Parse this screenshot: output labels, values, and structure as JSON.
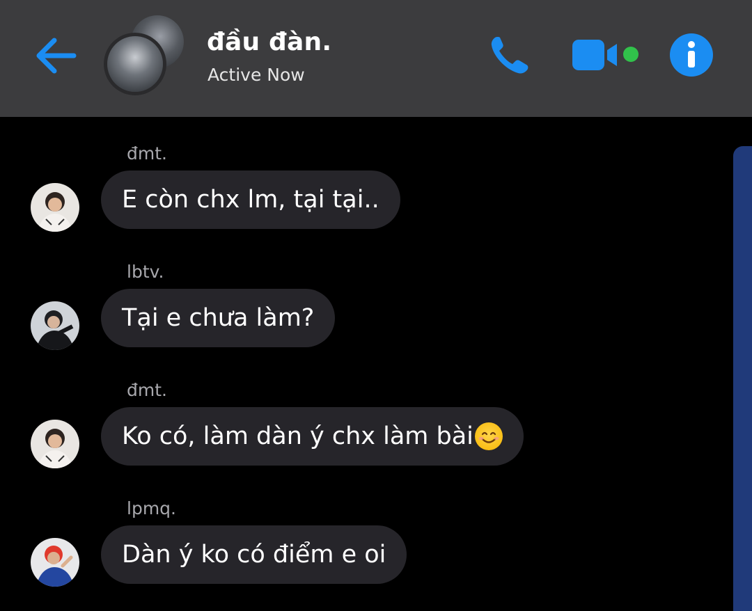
{
  "header": {
    "contact_name": "đầu đàn.",
    "status": "Active Now",
    "accent_color": "#1b8df2",
    "active_color": "#31c24b",
    "icons": [
      "back-arrow-icon",
      "phone-icon",
      "video-camera-icon",
      "info-icon"
    ]
  },
  "messages": [
    {
      "sender": "đmt.",
      "text": "E còn chx lm, tại tại..",
      "avatar": "avatar-dmt"
    },
    {
      "sender": "lbtv.",
      "text": "Tại e chưa làm?",
      "avatar": "avatar-lbtv"
    },
    {
      "sender": "đmt.",
      "text": "Ko có, làm dàn ý chx làm bài",
      "emoji": "smiling-face-emoji",
      "avatar": "avatar-dmt"
    },
    {
      "sender": "lpmq.",
      "text": "Dàn ý ko có điểm e oi",
      "avatar": "avatar-lpmq"
    }
  ],
  "colors": {
    "header_bg": "#3c3c3e",
    "bubble_bg": "#26252a",
    "background": "#000000",
    "scrollbar": "#203a7a"
  }
}
